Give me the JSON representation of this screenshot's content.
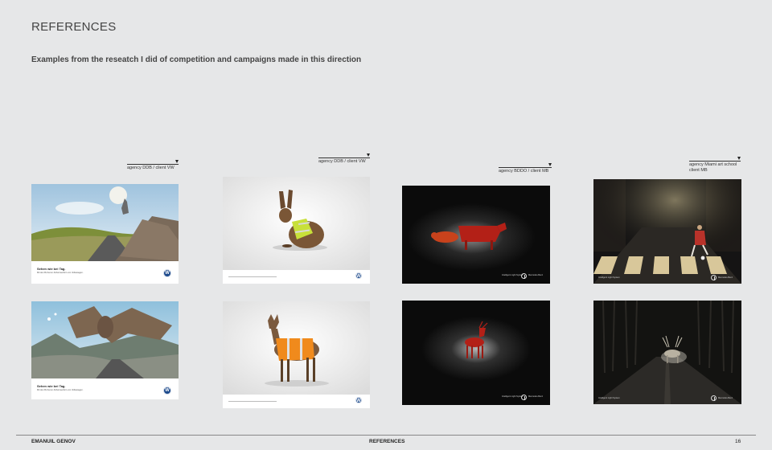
{
  "page": {
    "title": "REFERENCES",
    "subtitle": "Examples from the reseatch I did of competition and campaigns made in this direction"
  },
  "captions": [
    {
      "line1": "agency DDB / client VW",
      "line2": ""
    },
    {
      "line1": "agency DDB / client VW",
      "line2": ""
    },
    {
      "line1": "agency BDDO / client MB",
      "line2": ""
    },
    {
      "line1": "agency Miami art school",
      "line2": "client MB"
    }
  ],
  "ads": {
    "vw_ad_headline": "Sehen wie bei Tag.",
    "vw_ad_sub": "Mit den Bi-Xenon-Scheinwerfern von Volkswagen.",
    "vw_logo_text": "Volkswagen",
    "mb_brand": "Mercedes-Benz",
    "mb_sub": "Intelligent Light System"
  },
  "footer": {
    "author": "EMANUIL GENOV",
    "section": "REFERENCES",
    "page_number": "16"
  },
  "colors": {
    "background": "#e6e7e8",
    "vw_blue": "#1d4a8c",
    "mb_dark": "#0b0b0b",
    "safety_yellow": "#c8e03a",
    "safety_orange": "#f08a1c"
  }
}
